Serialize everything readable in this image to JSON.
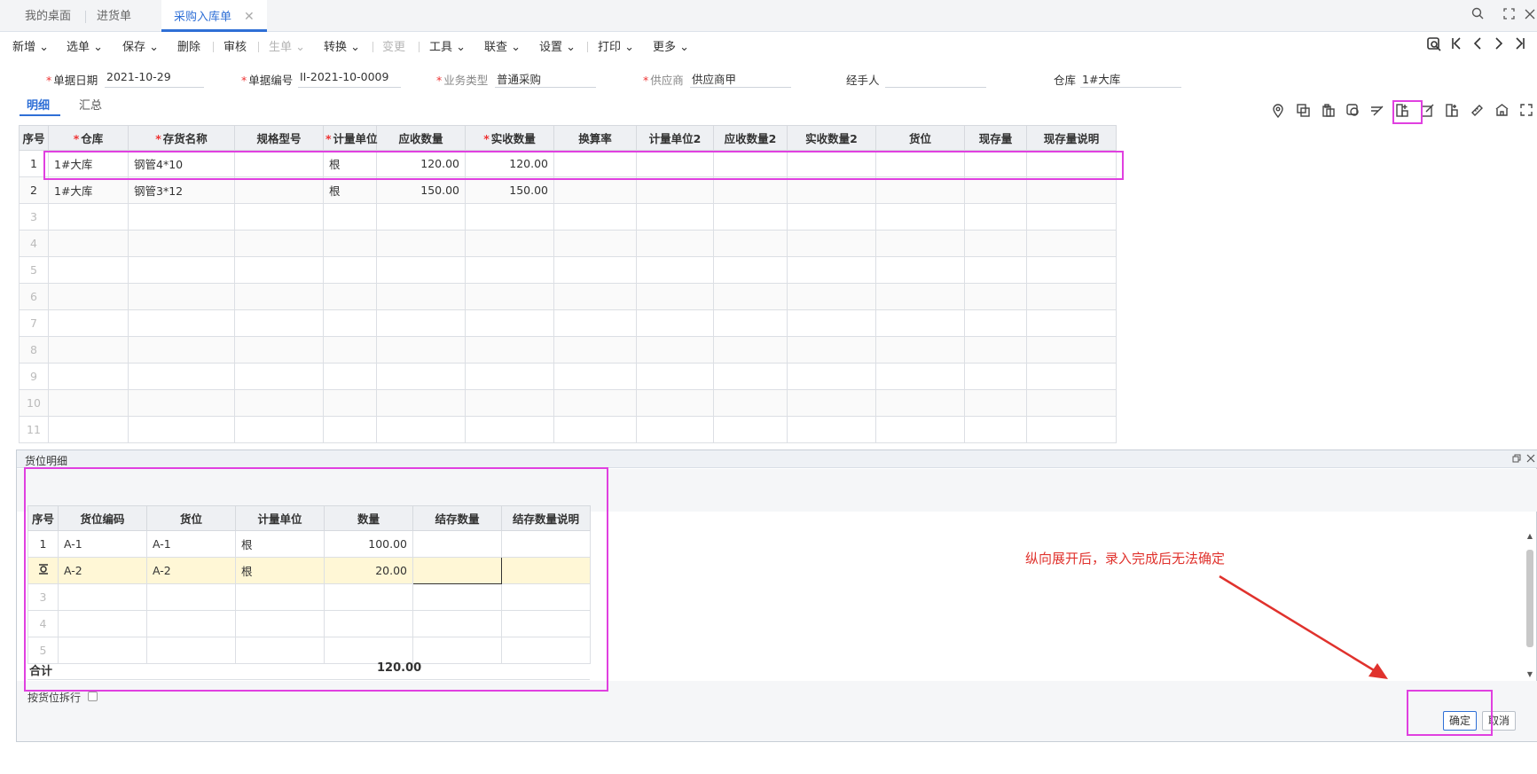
{
  "tabs": [
    {
      "label": "我的桌面",
      "active": false
    },
    {
      "label": "进货单",
      "active": false
    },
    {
      "label": "采购入库单",
      "active": true
    }
  ],
  "tab_close_glyph": "✕",
  "tabbar_icons": [
    "search-icon",
    "fullscreen-icon",
    "close-icon"
  ],
  "toolbar": {
    "items": [
      {
        "label": "新增",
        "dropdown": true,
        "disabled": false
      },
      {
        "label": "选单",
        "dropdown": true,
        "disabled": false
      },
      {
        "label": "保存",
        "dropdown": true,
        "disabled": false
      },
      {
        "label": "删除",
        "dropdown": false,
        "disabled": false
      },
      {
        "label": "审核",
        "dropdown": false,
        "disabled": false
      },
      {
        "label": "生单",
        "dropdown": true,
        "disabled": true
      },
      {
        "label": "转换",
        "dropdown": true,
        "disabled": false
      },
      {
        "label": "变更",
        "dropdown": false,
        "disabled": true
      },
      {
        "label": "工具",
        "dropdown": true,
        "disabled": false
      },
      {
        "label": "联查",
        "dropdown": true,
        "disabled": false
      },
      {
        "label": "设置",
        "dropdown": true,
        "disabled": false
      },
      {
        "label": "打印",
        "dropdown": true,
        "disabled": false
      },
      {
        "label": "更多",
        "dropdown": true,
        "disabled": false
      }
    ],
    "nav_icons": [
      "locate-icon",
      "first-icon",
      "prev-icon",
      "next-icon",
      "last-icon"
    ]
  },
  "form": {
    "date": {
      "label": "单据日期",
      "value": "2021-10-29",
      "required": true
    },
    "number": {
      "label": "单据编号",
      "value": "II-2021-10-0009",
      "required": true
    },
    "biz_type": {
      "label": "业务类型",
      "value": "普通采购",
      "required": true
    },
    "supplier": {
      "label": "供应商",
      "value": "供应商甲",
      "required": true
    },
    "handler": {
      "label": "经手人",
      "value": ""
    },
    "warehouse": {
      "label": "仓库",
      "value": "1#大库"
    }
  },
  "subtabs": [
    {
      "label": "明细",
      "active": true
    },
    {
      "label": "汇总",
      "active": false
    }
  ],
  "right_icons": [
    "location-icon",
    "copy-row-icon",
    "paste-row-icon",
    "batch-icon",
    "sign-icon",
    "add-column-icon",
    "edit-icon",
    "split-icon",
    "ruler-icon",
    "bank-icon",
    "expand-icon"
  ],
  "main_grid": {
    "columns": [
      {
        "label": "序号",
        "required": false
      },
      {
        "label": "仓库",
        "required": true
      },
      {
        "label": "存货名称",
        "required": true
      },
      {
        "label": "规格型号",
        "required": false
      },
      {
        "label": "计量单位",
        "required": true
      },
      {
        "label": "应收数量",
        "required": false
      },
      {
        "label": "实收数量",
        "required": true
      },
      {
        "label": "换算率",
        "required": false
      },
      {
        "label": "计量单位2",
        "required": false
      },
      {
        "label": "应收数量2",
        "required": false
      },
      {
        "label": "实收数量2",
        "required": false
      },
      {
        "label": "货位",
        "required": false
      },
      {
        "label": "现存量",
        "required": false
      },
      {
        "label": "现存量说明",
        "required": false
      }
    ],
    "rows": [
      [
        "1",
        "1#大库",
        "钢管4*10",
        "",
        "根",
        "120.00",
        "120.00",
        "",
        "",
        "",
        "",
        "",
        "",
        ""
      ],
      [
        "2",
        "1#大库",
        "钢管3*12",
        "",
        "根",
        "150.00",
        "150.00",
        "",
        "",
        "",
        "",
        "",
        "",
        ""
      ],
      [
        "3",
        "",
        "",
        "",
        "",
        "",
        "",
        "",
        "",
        "",
        "",
        "",
        "",
        ""
      ],
      [
        "4",
        "",
        "",
        "",
        "",
        "",
        "",
        "",
        "",
        "",
        "",
        "",
        "",
        ""
      ],
      [
        "5",
        "",
        "",
        "",
        "",
        "",
        "",
        "",
        "",
        "",
        "",
        "",
        "",
        ""
      ],
      [
        "6",
        "",
        "",
        "",
        "",
        "",
        "",
        "",
        "",
        "",
        "",
        "",
        "",
        ""
      ],
      [
        "7",
        "",
        "",
        "",
        "",
        "",
        "",
        "",
        "",
        "",
        "",
        "",
        "",
        ""
      ],
      [
        "8",
        "",
        "",
        "",
        "",
        "",
        "",
        "",
        "",
        "",
        "",
        "",
        "",
        ""
      ],
      [
        "9",
        "",
        "",
        "",
        "",
        "",
        "",
        "",
        "",
        "",
        "",
        "",
        "",
        ""
      ],
      [
        "10",
        "",
        "",
        "",
        "",
        "",
        "",
        "",
        "",
        "",
        "",
        "",
        "",
        ""
      ],
      [
        "11",
        "",
        "",
        "",
        "",
        "",
        "",
        "",
        "",
        "",
        "",
        "",
        "",
        ""
      ]
    ]
  },
  "dialog": {
    "title": "货位明细",
    "columns": [
      "序号",
      "货位编码",
      "货位",
      "计量单位",
      "数量",
      "结存数量",
      "结存数量说明"
    ],
    "rows": [
      [
        "1",
        "A-1",
        "A-1",
        "根",
        "100.00",
        "",
        ""
      ],
      [
        "",
        "A-2",
        "A-2",
        "根",
        "20.00",
        "",
        ""
      ],
      [
        "3",
        "",
        "",
        "",
        "",
        "",
        ""
      ],
      [
        "4",
        "",
        "",
        "",
        "",
        "",
        ""
      ],
      [
        "5",
        "",
        "",
        "",
        "",
        "",
        ""
      ]
    ],
    "total_label": "合计",
    "total_value": "120.00",
    "split_label": "按货位拆行",
    "ok_label": "确定",
    "cancel_label": "取消"
  },
  "annotation": "纵向展开后，录入完成后无法确定",
  "colors": {
    "accent": "#2f6fd6",
    "highlight": "#e040e0",
    "annotation": "#e0322d",
    "selected_row": "#fff7d6"
  }
}
